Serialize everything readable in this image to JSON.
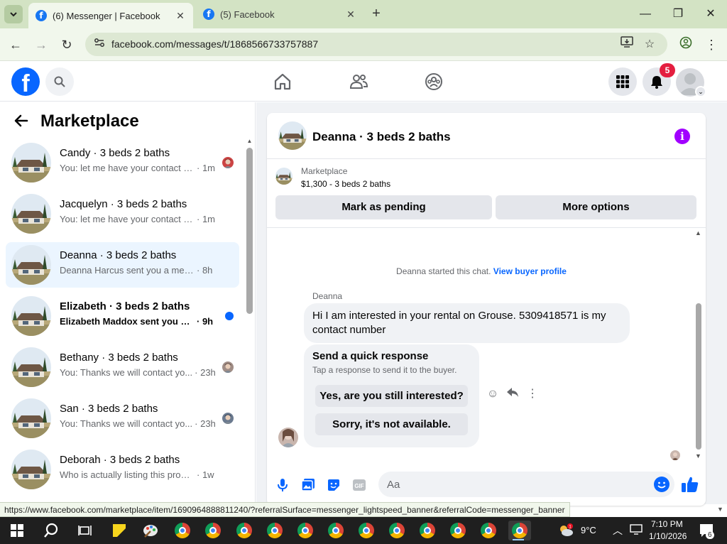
{
  "browser": {
    "tabs": [
      {
        "title": "(6) Messenger | Facebook",
        "active": true
      },
      {
        "title": "(5) Facebook",
        "active": false
      }
    ],
    "url": "facebook.com/messages/t/1868566733757887",
    "status_url": "https://www.facebook.com/marketplace/item/1690964888811240/?referralSurface=messenger_lightspeed_banner&referralCode=messenger_banner"
  },
  "fb_header": {
    "logo_letter": "f",
    "notifications_count": "5"
  },
  "left_panel": {
    "title": "Marketplace",
    "conversations": [
      {
        "name": "Candy · 3 beds 2 baths",
        "preview": "You: let me have your contact n...",
        "time": "· 1m",
        "unread": false,
        "selected": false,
        "indicator": "avatar"
      },
      {
        "name": "Jacquelyn · 3 beds 2 baths",
        "preview": "You: let me have your contact num...",
        "time": "· 1m",
        "unread": false,
        "selected": false,
        "indicator": "none"
      },
      {
        "name": "Deanna · 3 beds 2 baths",
        "preview": "Deanna Harcus sent you a message...",
        "time": "· 8h",
        "unread": false,
        "selected": true,
        "indicator": "none"
      },
      {
        "name": "Elizabeth · 3 beds 2 baths",
        "preview": "Elizabeth Maddox sent you a m...",
        "time": "· 9h",
        "unread": true,
        "selected": false,
        "indicator": "dot"
      },
      {
        "name": "Bethany · 3 beds 2 baths",
        "preview": "You: Thanks we will contact yo...",
        "time": "· 23h",
        "unread": false,
        "selected": false,
        "indicator": "avatar"
      },
      {
        "name": "San · 3 beds 2 baths",
        "preview": "You: Thanks we will contact yo...",
        "time": "· 23h",
        "unread": false,
        "selected": false,
        "indicator": "avatar"
      },
      {
        "name": "Deborah · 3 beds 2 baths",
        "preview": "Who is actually listing this propert...",
        "time": "· 1w",
        "unread": false,
        "selected": false,
        "indicator": "none"
      }
    ]
  },
  "chat": {
    "title": "Deanna · 3 beds 2 baths",
    "listing_kicker": "Marketplace",
    "listing_line": "$1,300 - 3 beds 2 baths",
    "mark_pending_label": "Mark as pending",
    "more_options_label": "More options",
    "started_text": "Deanna started this chat.",
    "view_profile_label": "View buyer profile",
    "sender": "Deanna",
    "message": "Hi I am interested in your rental on Grouse. 5309418571 is my contact number",
    "quick_title": "Send a quick response",
    "quick_subtitle": "Tap a response to send it to the buyer.",
    "quick_options": [
      "Yes, are you still interested?",
      "Sorry, it's not available."
    ],
    "composer_placeholder": "Aa"
  },
  "taskbar": {
    "weather": "9°C",
    "time": "7:10 PM",
    "date": "1/10/2026",
    "notification_count": "6"
  },
  "colors": {
    "fb_blue": "#0866ff",
    "selected_bg": "#ebf5ff",
    "badge_red": "#e41e3f",
    "info_purple": "#a100ff"
  }
}
